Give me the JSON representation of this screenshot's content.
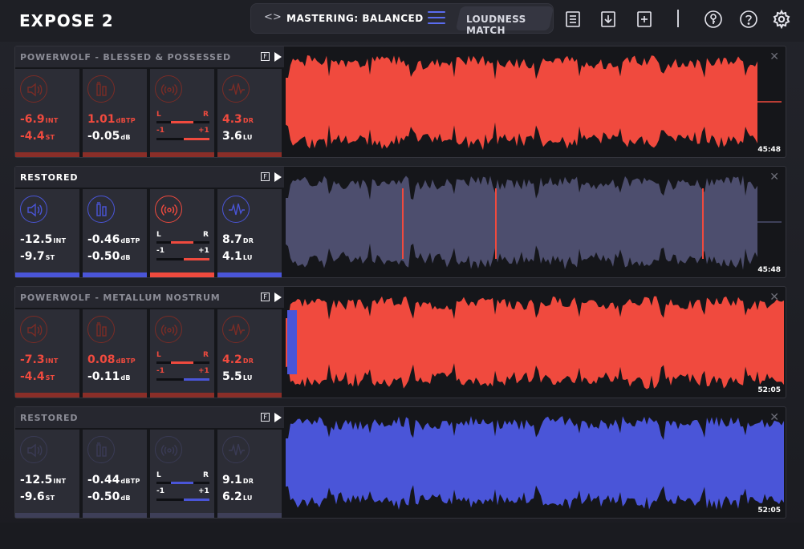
{
  "app": {
    "title": "EXPOSE 2"
  },
  "toolbar": {
    "preset_arrows": "<>",
    "preset_label": "MASTERING: BALANCED",
    "loudness_match": "LOUDNESS MATCH",
    "icons": [
      "list-icon",
      "import-icon",
      "add-icon",
      "key-icon",
      "help-icon",
      "settings-icon"
    ]
  },
  "colors": {
    "red": "#f04a3e",
    "blue": "#4a55d8",
    "slate": "#4d4e6e",
    "muted": "#5a4242"
  },
  "tracks": [
    {
      "name": "POWERWOLF - BLESSED & POSSESSED",
      "int": "-6.9",
      "int_unit": "INT",
      "st": "-4.4",
      "st_unit": "ST",
      "dbtp": "1.01",
      "dbtp_unit": "dBTP",
      "db": "-0.05",
      "db_unit": "dB",
      "l": "L",
      "r": "R",
      "minus": "-1",
      "plus": "+1",
      "dr": "4.3",
      "dr_unit": "DR",
      "lu": "3.6",
      "lu_unit": "LU",
      "time": "45:48",
      "close": "✕"
    },
    {
      "name": "RESTORED",
      "int": "-12.5",
      "int_unit": "INT",
      "st": "-9.7",
      "st_unit": "ST",
      "dbtp": "-0.46",
      "dbtp_unit": "dBTP",
      "db": "-0.50",
      "db_unit": "dB",
      "l": "L",
      "r": "R",
      "minus": "-1",
      "plus": "+1",
      "dr": "8.7",
      "dr_unit": "DR",
      "lu": "4.1",
      "lu_unit": "LU",
      "time": "45:48",
      "close": "✕"
    },
    {
      "name": "POWERWOLF - METALLUM NOSTRUM",
      "int": "-7.3",
      "int_unit": "INT",
      "st": "-4.4",
      "st_unit": "ST",
      "dbtp": "0.08",
      "dbtp_unit": "dBTP",
      "db": "-0.11",
      "db_unit": "dB",
      "l": "L",
      "r": "R",
      "minus": "-1",
      "plus": "+1",
      "dr": "4.2",
      "dr_unit": "DR",
      "lu": "5.5",
      "lu_unit": "LU",
      "time": "52:05",
      "close": "✕"
    },
    {
      "name": "RESTORED",
      "int": "-12.5",
      "int_unit": "INT",
      "st": "-9.6",
      "st_unit": "ST",
      "dbtp": "-0.44",
      "dbtp_unit": "dBTP",
      "db": "-0.50",
      "db_unit": "dB",
      "l": "L",
      "r": "R",
      "minus": "-1",
      "plus": "+1",
      "dr": "9.1",
      "dr_unit": "DR",
      "lu": "6.2",
      "lu_unit": "LU",
      "time": "52:05",
      "close": "✕"
    }
  ]
}
